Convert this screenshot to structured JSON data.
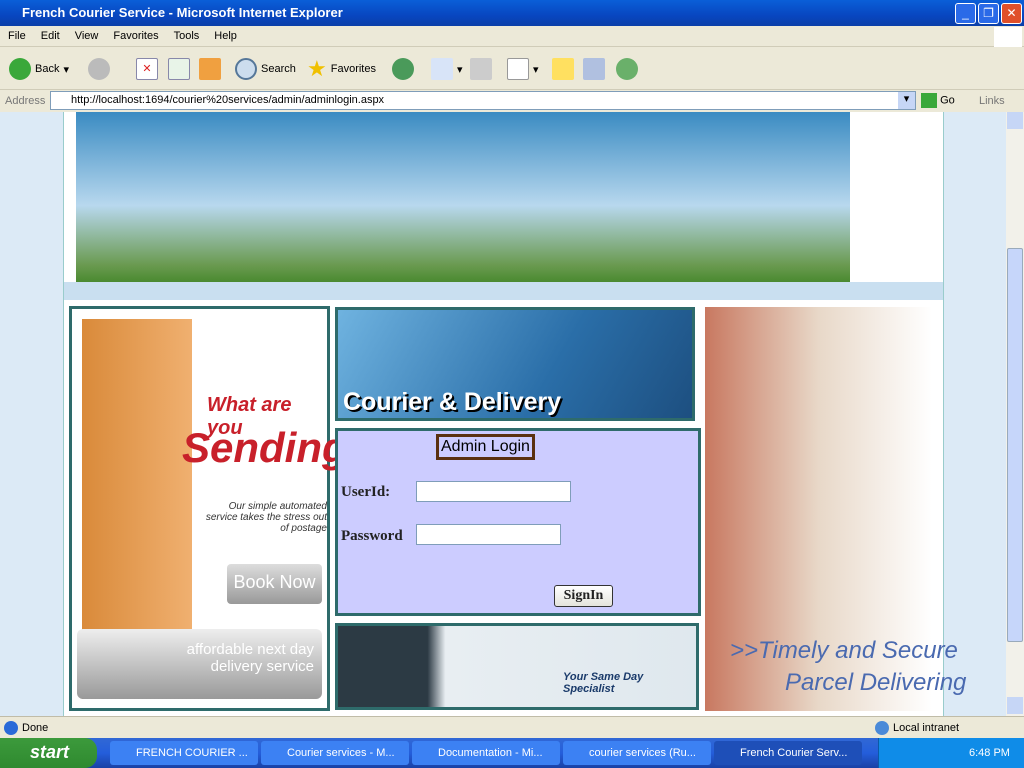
{
  "window": {
    "title": "French Courier Service - Microsoft Internet Explorer"
  },
  "menu": [
    "File",
    "Edit",
    "View",
    "Favorites",
    "Tools",
    "Help"
  ],
  "toolbar": {
    "back": "Back",
    "search": "Search",
    "favorites": "Favorites"
  },
  "address": {
    "label": "Address",
    "url": "http://localhost:1694/courier%20services/admin/adminlogin.aspx",
    "go": "Go",
    "links": "Links"
  },
  "page": {
    "left_ad": {
      "line1": "What are you",
      "line2": "Sending?",
      "tagline": "Our simple automated service takes the stress out of postage",
      "book": "Book Now",
      "footer": "affordable next day delivery service"
    },
    "middle_banner": "Courier & Delivery",
    "login": {
      "title": "Admin Login",
      "userid_label": "UserId:",
      "password_label": "Password",
      "userid_value": "",
      "password_value": "",
      "signin": "SignIn"
    },
    "bottom_banner": "Your Same Day Specialist",
    "right_ad": {
      "line1": ">>Timely and Secure",
      "line2": "Parcel Delivering"
    }
  },
  "status": {
    "text": "Done",
    "zone": "Local intranet"
  },
  "taskbar": {
    "start": "start",
    "tasks": [
      "FRENCH COURIER ...",
      "Courier services - M...",
      "Documentation - Mi...",
      "courier services (Ru...",
      "French Courier Serv..."
    ],
    "clock": "6:48 PM"
  }
}
